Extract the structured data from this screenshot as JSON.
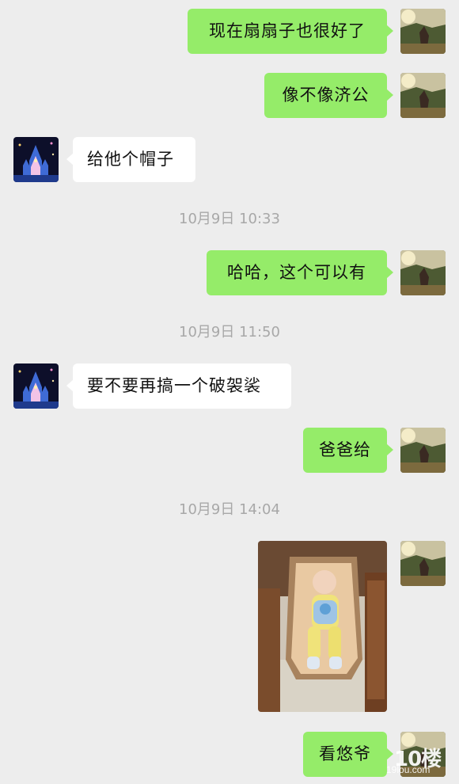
{
  "messages": [
    {
      "side": "sent",
      "text": "现在扇扇子也很好了"
    },
    {
      "side": "sent",
      "text": "像不像济公"
    },
    {
      "side": "received",
      "text": "给他个帽子"
    },
    {
      "side": "sent",
      "text": "哈哈，这个可以有"
    },
    {
      "side": "received",
      "text": "要不要再搞一个破袈裟"
    },
    {
      "side": "sent",
      "text": "爸爸给"
    },
    {
      "side": "sent",
      "type": "image",
      "image_description": "baby-in-lounge-chair-photo"
    },
    {
      "side": "sent",
      "text": "看悠爷"
    }
  ],
  "timestamps": [
    "10月9日 10:33",
    "10月9日 11:50",
    "10月9日 14:04"
  ],
  "avatars": {
    "self": "landscape-sunset-avatar",
    "other": "castle-fireworks-avatar"
  },
  "watermark": {
    "big": "10楼",
    "small": "19lou.com"
  },
  "colors": {
    "background": "#ededed",
    "sent_bubble": "#95ec69",
    "received_bubble": "#ffffff",
    "timestamp_text": "#a8a8a8"
  }
}
